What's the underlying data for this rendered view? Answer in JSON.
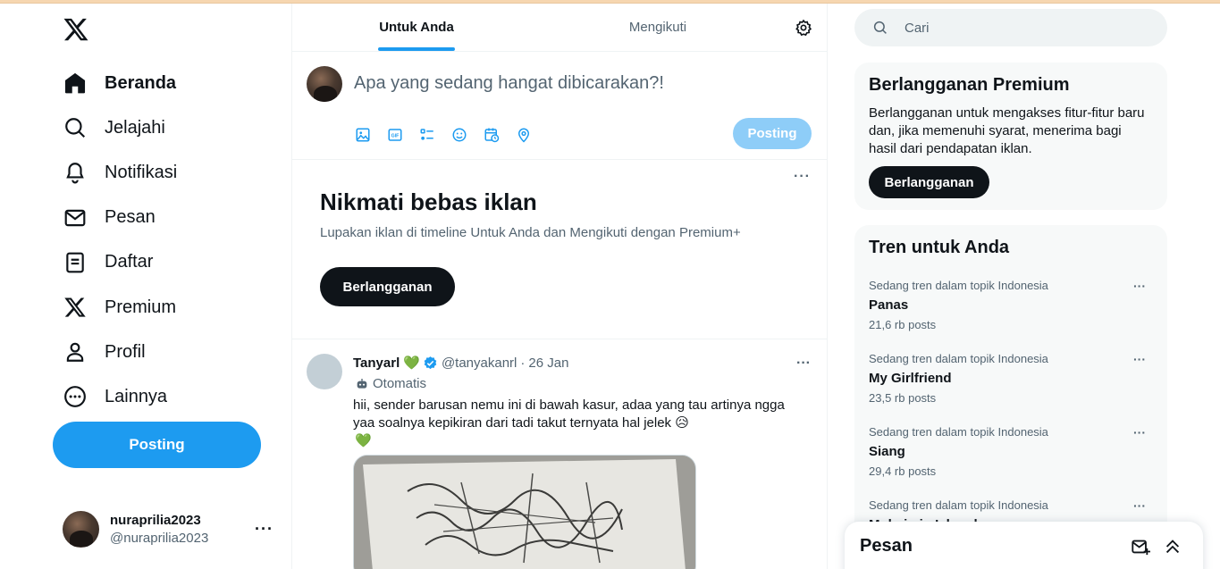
{
  "sidebar": {
    "nav": [
      {
        "label": "Beranda",
        "icon": "home-icon",
        "active": true
      },
      {
        "label": "Jelajahi",
        "icon": "search-icon"
      },
      {
        "label": "Notifikasi",
        "icon": "bell-icon"
      },
      {
        "label": "Pesan",
        "icon": "mail-icon"
      },
      {
        "label": "Daftar",
        "icon": "list-icon"
      },
      {
        "label": "Premium",
        "icon": "x-logo-icon"
      },
      {
        "label": "Profil",
        "icon": "person-icon"
      },
      {
        "label": "Lainnya",
        "icon": "more-circle-icon"
      }
    ],
    "post_button": "Posting",
    "account": {
      "display_name": "nuraprilia2023",
      "handle": "@nuraprilia2023",
      "more": "···"
    }
  },
  "main": {
    "tabs": [
      {
        "label": "Untuk Anda",
        "active": true
      },
      {
        "label": "Mengikuti",
        "active": false
      }
    ],
    "compose": {
      "placeholder": "Apa yang sedang hangat dibicarakan?!",
      "post_button": "Posting",
      "tools": [
        "image-icon",
        "gif-icon",
        "poll-icon",
        "emoji-icon",
        "schedule-icon",
        "location-icon"
      ]
    },
    "promo": {
      "title": "Nikmati bebas iklan",
      "text": "Lupakan iklan di timeline Untuk Anda dan Mengikuti dengan Premium+",
      "button": "Berlangganan",
      "more": "···"
    },
    "tweet": {
      "name": "Tanyarl",
      "heart": "💚",
      "handle": "@tanyakanrl",
      "sep": "·",
      "date": "26 Jan",
      "automated": "Otomatis",
      "text": "hii, sender barusan nemu ini di bawah kasur, adaa yang tau artinya ngga yaa soalnya kepikiran dari tadi takut ternyata hal jelek 😥",
      "text2": "💚",
      "more": "···"
    }
  },
  "right": {
    "search_placeholder": "Cari",
    "premium": {
      "title": "Berlangganan Premium",
      "text": "Berlangganan untuk mengakses fitur-fitur baru dan, jika memenuhi syarat, menerima bagi hasil dari pendapatan iklan.",
      "button": "Berlangganan"
    },
    "trends": {
      "title": "Tren untuk Anda",
      "items": [
        {
          "context": "Sedang tren dalam topik Indonesia",
          "name": "Panas",
          "count": "21,6 rb posts"
        },
        {
          "context": "Sedang tren dalam topik Indonesia",
          "name": "My Girlfriend",
          "count": "23,5 rb posts"
        },
        {
          "context": "Sedang tren dalam topik Indonesia",
          "name": "Siang",
          "count": "29,4 rb posts"
        },
        {
          "context": "Sedang tren dalam topik Indonesia",
          "name": "Muhaimin Iskandar",
          "count": ""
        }
      ],
      "more": "···"
    }
  },
  "dm_drawer": {
    "title": "Pesan"
  },
  "colors": {
    "accent": "#1d9bf0",
    "text": "#0f1419",
    "muted": "#536471"
  }
}
